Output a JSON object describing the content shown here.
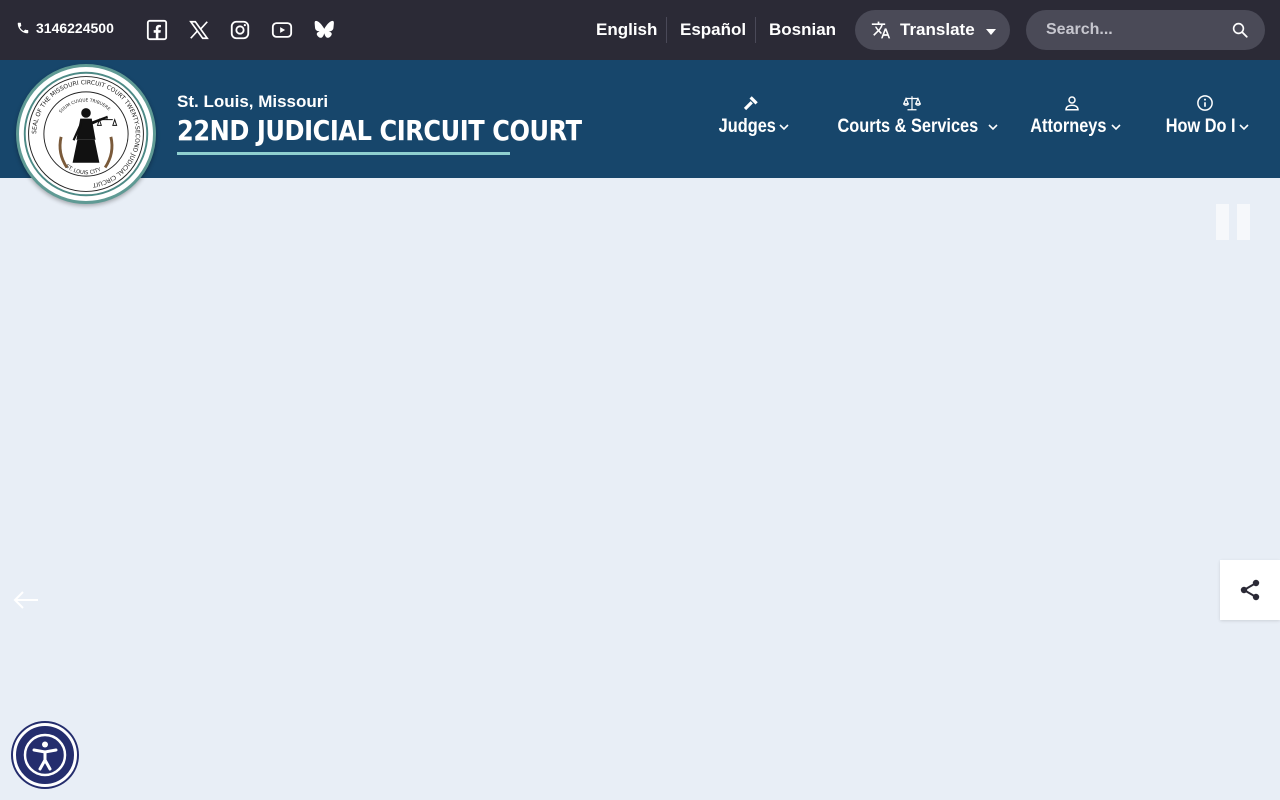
{
  "topbar": {
    "phone": "3146224500",
    "social": [
      {
        "name": "facebook-icon"
      },
      {
        "name": "x-icon"
      },
      {
        "name": "instagram-icon"
      },
      {
        "name": "youtube-icon"
      },
      {
        "name": "bluesky-icon"
      }
    ],
    "languages": [
      "English",
      "Español",
      "Bosnian"
    ],
    "translate_label": "Translate",
    "search_placeholder": "Search..."
  },
  "header": {
    "subtitle": "St. Louis, Missouri",
    "title": "22ND JUDICIAL CIRCUIT COURT",
    "seal_text_outer": "SEAL OF THE MISSOURI CIRCUIT COURT TWENTY-SECOND JUDICIAL CIRCUIT",
    "seal_text_inner": "SUUM CUIQUE TRIBUERE",
    "seal_text_bottom": "ST. LOUIS CITY"
  },
  "nav": [
    {
      "label": "Judges",
      "icon": "gavel-icon"
    },
    {
      "label": "Courts & Services",
      "icon": "scales-icon"
    },
    {
      "label": "Attorneys",
      "icon": "person-icon"
    },
    {
      "label": "How Do I",
      "icon": "info-icon"
    }
  ],
  "colors": {
    "topbar_bg": "#2b2a36",
    "header_bg": "#17466b",
    "accent_underline": "#8fd0d0",
    "page_bg": "#e8eef6",
    "accessibility_bg": "#242d6d"
  }
}
